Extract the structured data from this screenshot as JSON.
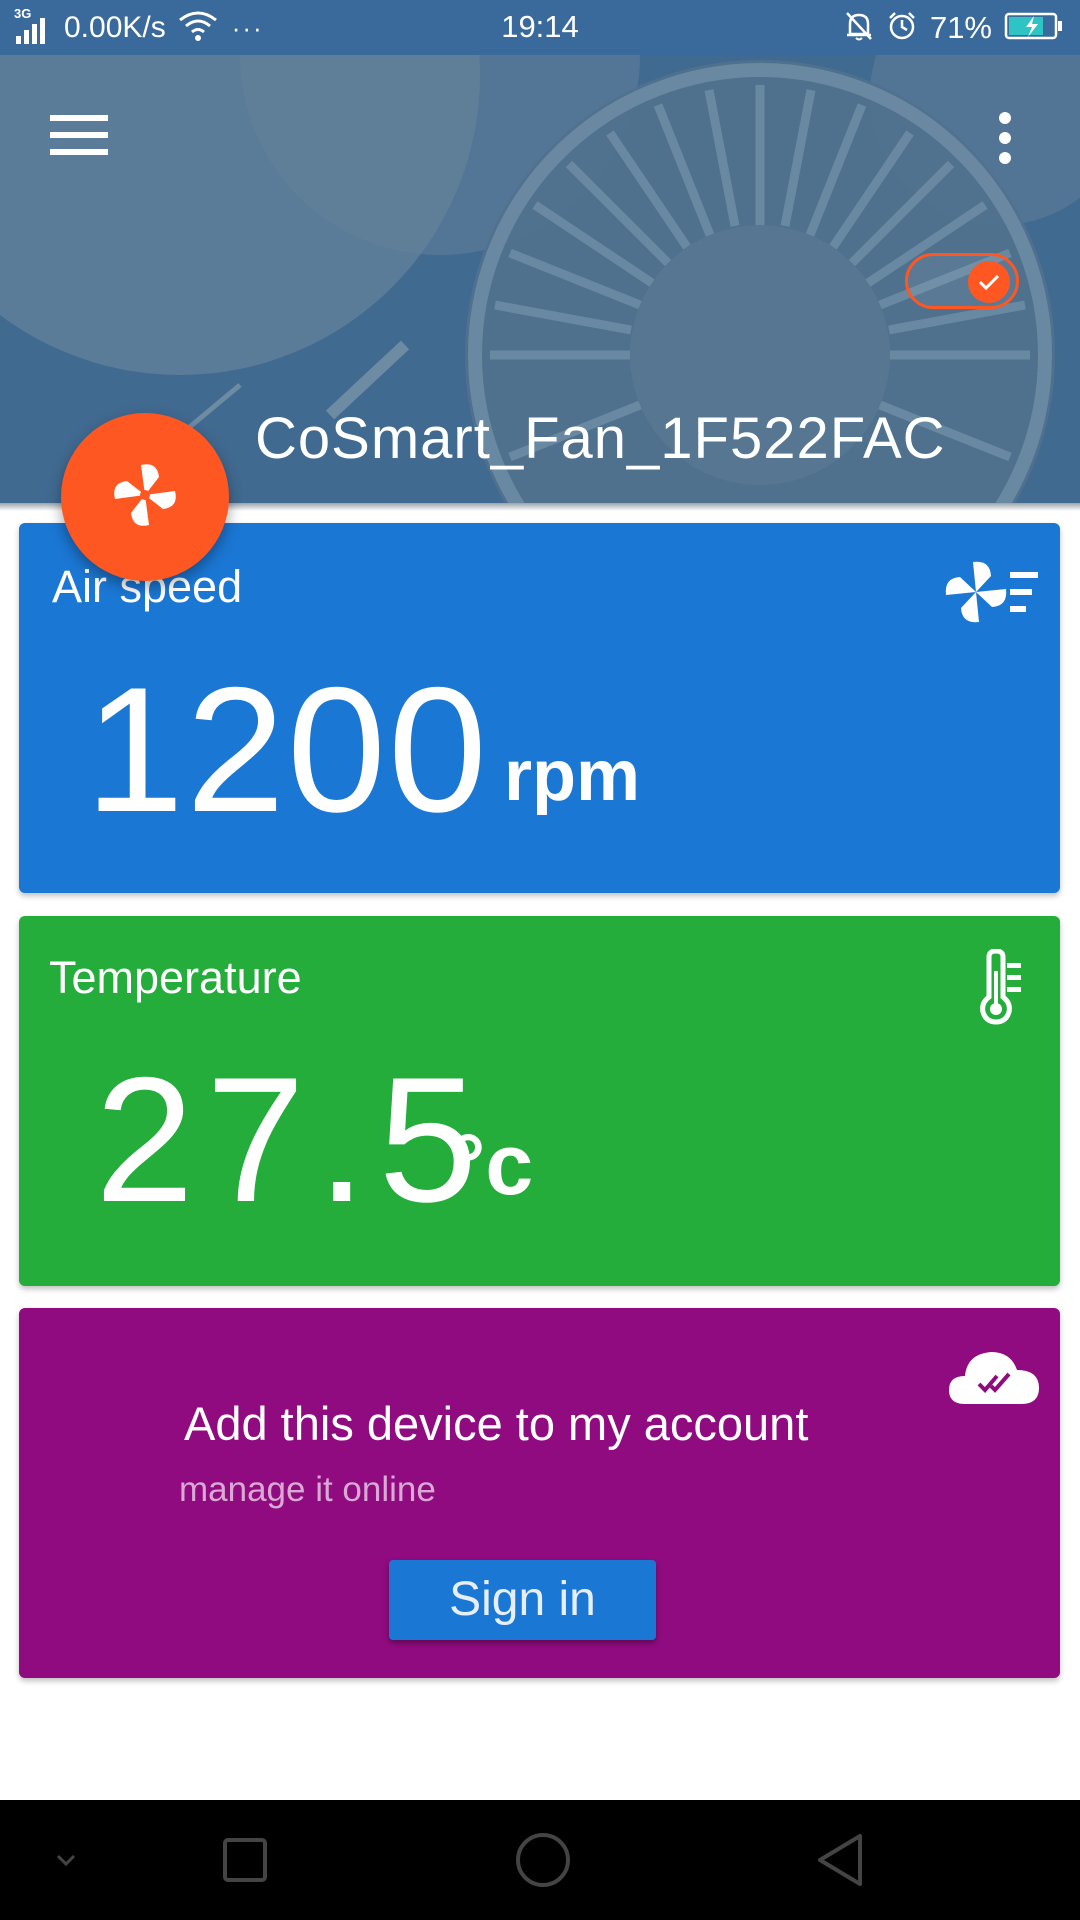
{
  "status_bar": {
    "network_type": "3G",
    "net_speed": "0.00K/s",
    "more": "···",
    "time": "19:14",
    "battery_percent": "71%"
  },
  "header": {
    "device_name": "CoSmart_Fan_1F522FAC",
    "power_on": true
  },
  "cards": {
    "air_speed": {
      "title": "Air speed",
      "value": "1200",
      "unit": "rpm",
      "color": "#1b77d4"
    },
    "temperature": {
      "title": "Temperature",
      "value": "27.5",
      "unit": "°c",
      "color": "#24ad3b"
    },
    "account": {
      "title": "Add this device to my account",
      "subtitle": "manage it online",
      "button_label": "Sign in",
      "color": "#900b80"
    }
  },
  "colors": {
    "accent": "#ff5722",
    "header_bg": "#4a6f8e",
    "status_bar_bg": "#3a6a9b"
  },
  "icons": {
    "menu": "hamburger-menu-icon",
    "overflow": "more-vert-icon",
    "fab": "fan-icon",
    "air_speed": "fan-speed-icon",
    "temperature": "thermometer-icon",
    "account": "cloud-check-icon"
  }
}
